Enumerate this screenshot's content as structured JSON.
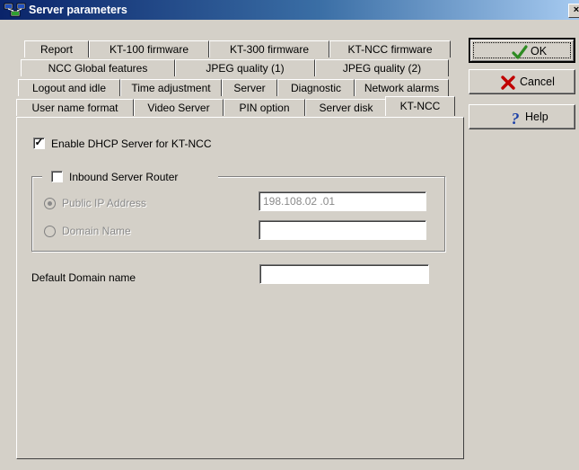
{
  "window": {
    "title": "Server parameters",
    "close_glyph": "×"
  },
  "tabs": {
    "row1": [
      "Report",
      "KT-100 firmware",
      "KT-300 firmware",
      "KT-NCC firmware"
    ],
    "row2": [
      "NCC Global features",
      "JPEG quality (1)",
      "JPEG quality (2)"
    ],
    "row3": [
      "Logout and idle",
      "Time adjustment",
      "Server",
      "Diagnostic",
      "Network alarms"
    ],
    "row4": [
      "User name format",
      "Video Server",
      "PIN option",
      "Server disk",
      "KT-NCC"
    ],
    "active": "KT-NCC"
  },
  "panel": {
    "enable_dhcp": {
      "label": "Enable DHCP Server for KT-NCC",
      "checked": true
    },
    "inbound_router": {
      "label": "Inbound Server Router",
      "checked": false
    },
    "public_ip": {
      "label": "Public IP Address",
      "selected": true,
      "value": "198.108.02 .01"
    },
    "domain_name": {
      "label": "Domain Name",
      "selected": false,
      "value": ""
    },
    "default_domain": {
      "label": "Default Domain name",
      "value": ""
    }
  },
  "buttons": {
    "ok": {
      "label": "OK",
      "icon": "checkmark-icon"
    },
    "cancel": {
      "label": "Cancel",
      "icon": "red-x-icon"
    },
    "help": {
      "label": "Help",
      "icon": "question-mark-icon"
    }
  },
  "colors": {
    "titlebar_start": "#0a246a",
    "titlebar_end": "#a6caf0",
    "ok_check": "#2e8b22",
    "cancel_x": "#c00000",
    "help_q": "#1a3fa8"
  }
}
